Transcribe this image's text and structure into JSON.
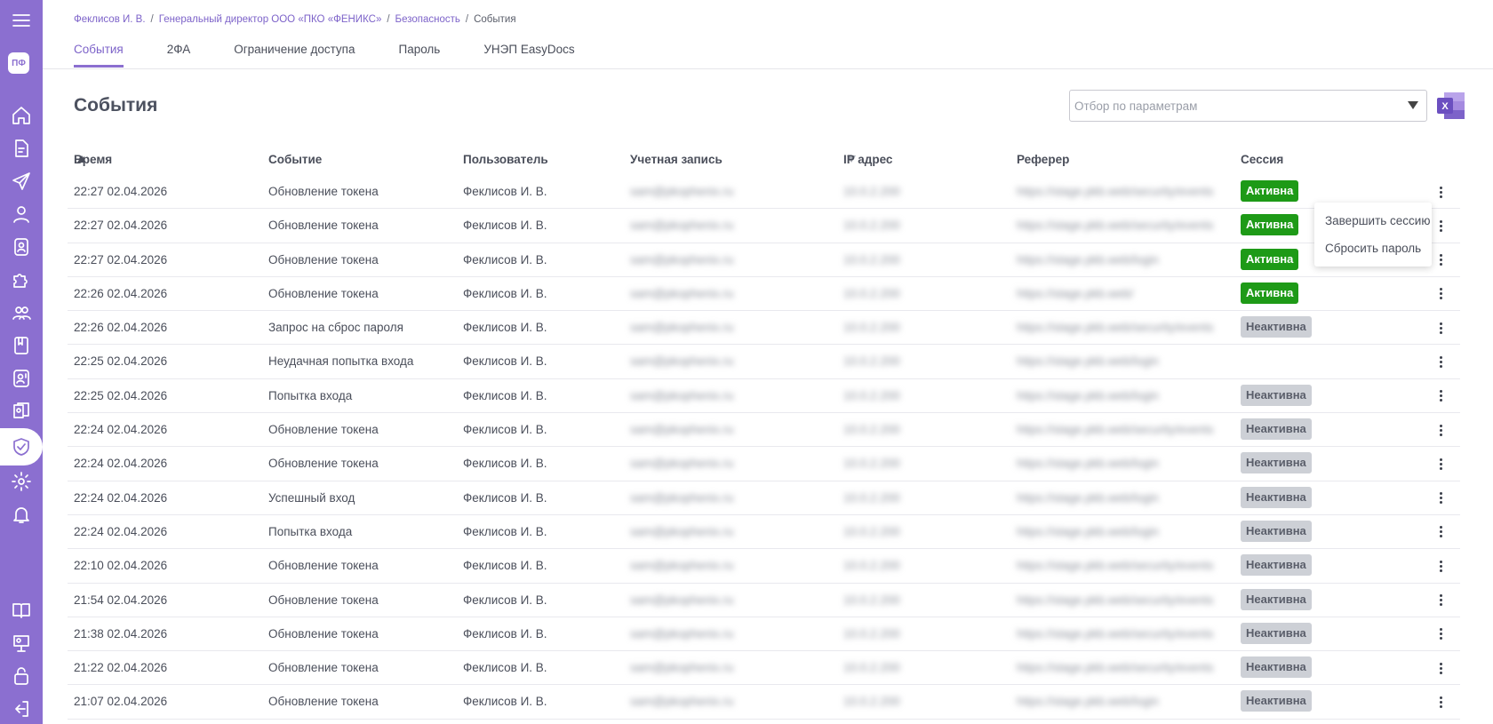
{
  "sidebar": {
    "logo": "ПФ",
    "icons": [
      "menu-icon",
      "home-icon",
      "document-icon",
      "send-icon",
      "user-icon",
      "badge-icon",
      "puzzle-icon",
      "users-icon",
      "book-icon",
      "contact-icon",
      "documents-icon",
      "shield-check-icon",
      "gear-icon",
      "bell-icon",
      "help-book-icon",
      "presentation-icon",
      "lock-icon",
      "logout-icon"
    ]
  },
  "breadcrumb": [
    "Феклисов И. В.",
    "Генеральный директор ООО «ПКО «ФЕНИКС»",
    "Безопасность",
    "События"
  ],
  "tabs": [
    "События",
    "2ФА",
    "Ограничение доступа",
    "Пароль",
    "УНЭП EasyDocs"
  ],
  "page": {
    "title": "События"
  },
  "filter": {
    "placeholder": "Отбор по параметрам"
  },
  "table": {
    "columns": [
      "Время",
      "Событие",
      "Пользователь",
      "Учетная запись",
      "IP адрес",
      "Реферер",
      "Сессия"
    ],
    "rows": [
      {
        "time": "22:27 02.04.2026",
        "event": "Обновление токена",
        "user": "Феклисов И. В.",
        "account": "sam@pkophenix.ru",
        "ip": "10.0.2.200",
        "referer": "https://stage.pkb.web/security/events",
        "session": "Активна"
      },
      {
        "time": "22:27 02.04.2026",
        "event": "Обновление токена",
        "user": "Феклисов И. В.",
        "account": "sam@pkophenix.ru",
        "ip": "10.0.2.200",
        "referer": "https://stage.pkb.web/security/events",
        "session": "Активна"
      },
      {
        "time": "22:27 02.04.2026",
        "event": "Обновление токена",
        "user": "Феклисов И. В.",
        "account": "sam@pkophenix.ru",
        "ip": "10.0.2.200",
        "referer": "https://stage.pkb.web/login",
        "session": "Активна"
      },
      {
        "time": "22:26 02.04.2026",
        "event": "Обновление токена",
        "user": "Феклисов И. В.",
        "account": "sam@pkophenix.ru",
        "ip": "10.0.2.200",
        "referer": "https://stage.pkb.web/",
        "session": "Активна"
      },
      {
        "time": "22:26 02.04.2026",
        "event": "Запрос на сброс пароля",
        "user": "Феклисов И. В.",
        "account": "sam@pkophenix.ru",
        "ip": "10.0.2.200",
        "referer": "https://stage.pkb.web/security/events",
        "session": "Неактивна"
      },
      {
        "time": "22:25 02.04.2026",
        "event": "Неудачная попытка входа",
        "user": "Феклисов И. В.",
        "account": "sam@pkophenix.ru",
        "ip": "10.0.2.200",
        "referer": "https://stage.pkb.web/login",
        "session": ""
      },
      {
        "time": "22:25 02.04.2026",
        "event": "Попытка входа",
        "user": "Феклисов И. В.",
        "account": "sam@pkophenix.ru",
        "ip": "10.0.2.200",
        "referer": "https://stage.pkb.web/login",
        "session": "Неактивна"
      },
      {
        "time": "22:24 02.04.2026",
        "event": "Обновление токена",
        "user": "Феклисов И. В.",
        "account": "sam@pkophenix.ru",
        "ip": "10.0.2.200",
        "referer": "https://stage.pkb.web/security/events",
        "session": "Неактивна"
      },
      {
        "time": "22:24 02.04.2026",
        "event": "Обновление токена",
        "user": "Феклисов И. В.",
        "account": "sam@pkophenix.ru",
        "ip": "10.0.2.200",
        "referer": "https://stage.pkb.web/login",
        "session": "Неактивна"
      },
      {
        "time": "22:24 02.04.2026",
        "event": "Успешный вход",
        "user": "Феклисов И. В.",
        "account": "sam@pkophenix.ru",
        "ip": "10.0.2.200",
        "referer": "https://stage.pkb.web/login",
        "session": "Неактивна"
      },
      {
        "time": "22:24 02.04.2026",
        "event": "Попытка входа",
        "user": "Феклисов И. В.",
        "account": "sam@pkophenix.ru",
        "ip": "10.0.2.200",
        "referer": "https://stage.pkb.web/login",
        "session": "Неактивна"
      },
      {
        "time": "22:10 02.04.2026",
        "event": "Обновление токена",
        "user": "Феклисов И. В.",
        "account": "sam@pkophenix.ru",
        "ip": "10.0.2.200",
        "referer": "https://stage.pkb.web/security/events",
        "session": "Неактивна"
      },
      {
        "time": "21:54 02.04.2026",
        "event": "Обновление токена",
        "user": "Феклисов И. В.",
        "account": "sam@pkophenix.ru",
        "ip": "10.0.2.200",
        "referer": "https://stage.pkb.web/security/events",
        "session": "Неактивна"
      },
      {
        "time": "21:38 02.04.2026",
        "event": "Обновление токена",
        "user": "Феклисов И. В.",
        "account": "sam@pkophenix.ru",
        "ip": "10.0.2.200",
        "referer": "https://stage.pkb.web/security/events",
        "session": "Неактивна"
      },
      {
        "time": "21:22 02.04.2026",
        "event": "Обновление токена",
        "user": "Феклисов И. В.",
        "account": "sam@pkophenix.ru",
        "ip": "10.0.2.200",
        "referer": "https://stage.pkb.web/security/events",
        "session": "Неактивна"
      },
      {
        "time": "21:07 02.04.2026",
        "event": "Обновление токена",
        "user": "Феклисов И. В.",
        "account": "sam@pkophenix.ru",
        "ip": "10.0.2.200",
        "referer": "https://stage.pkb.web/login",
        "session": "Неактивна"
      }
    ]
  },
  "context_menu": {
    "items": [
      "Завершить сессию",
      "Сбросить пароль"
    ]
  },
  "colors": {
    "accent": "#8b6fd0",
    "active_badge": "#1e9a17",
    "inactive_badge": "#cdd0d6"
  }
}
